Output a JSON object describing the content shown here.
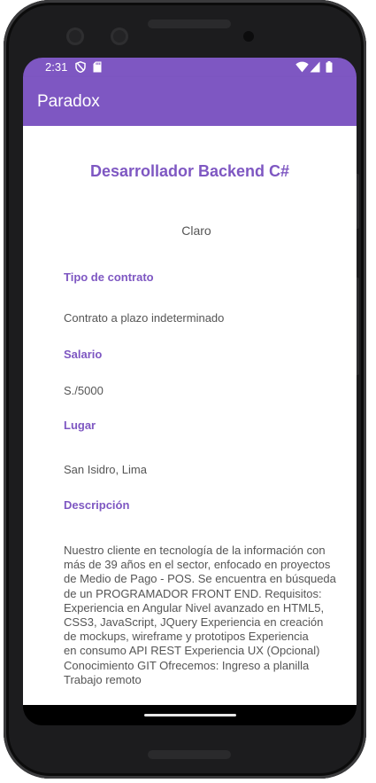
{
  "status_bar": {
    "time": "2:31",
    "icons": [
      "shield-icon",
      "sd-card-icon",
      "wifi-icon",
      "signal-icon",
      "battery-icon"
    ]
  },
  "app_bar": {
    "title": "Paradox"
  },
  "job": {
    "title": "Desarrollador Backend C#",
    "company": "Claro",
    "contract_label": "Tipo de contrato",
    "contract_value": "Contrato a plazo indeterminado",
    "salary_label": "Salario",
    "salary_value": "S./5000",
    "location_label": "Lugar",
    "location_value": "San Isidro, Lima",
    "description_label": "Descripción",
    "description_lines": [
      "Nuestro cliente en tecnología de la información con",
      "más de 39 años en el sector, enfocado en proyectos",
      "de Medio de Pago - POS. Se encuentra en búsqueda",
      "de un PROGRAMADOR FRONT END. Requisitos:",
      "Experiencia en Angular Nivel avanzado en HTML5,",
      "CSS3, JavaScript, JQuery Experiencia en creación",
      "de mockups, wireframe y prototipos Experiencia",
      "en consumo API REST Experiencia UX (Opcional)",
      "Conocimiento GIT Ofrecemos: Ingreso a planilla",
      "Trabajo remoto"
    ]
  },
  "colors": {
    "primary": "#7e57c2",
    "text_secondary": "#555555",
    "device_frame": "#1c1c1e"
  }
}
